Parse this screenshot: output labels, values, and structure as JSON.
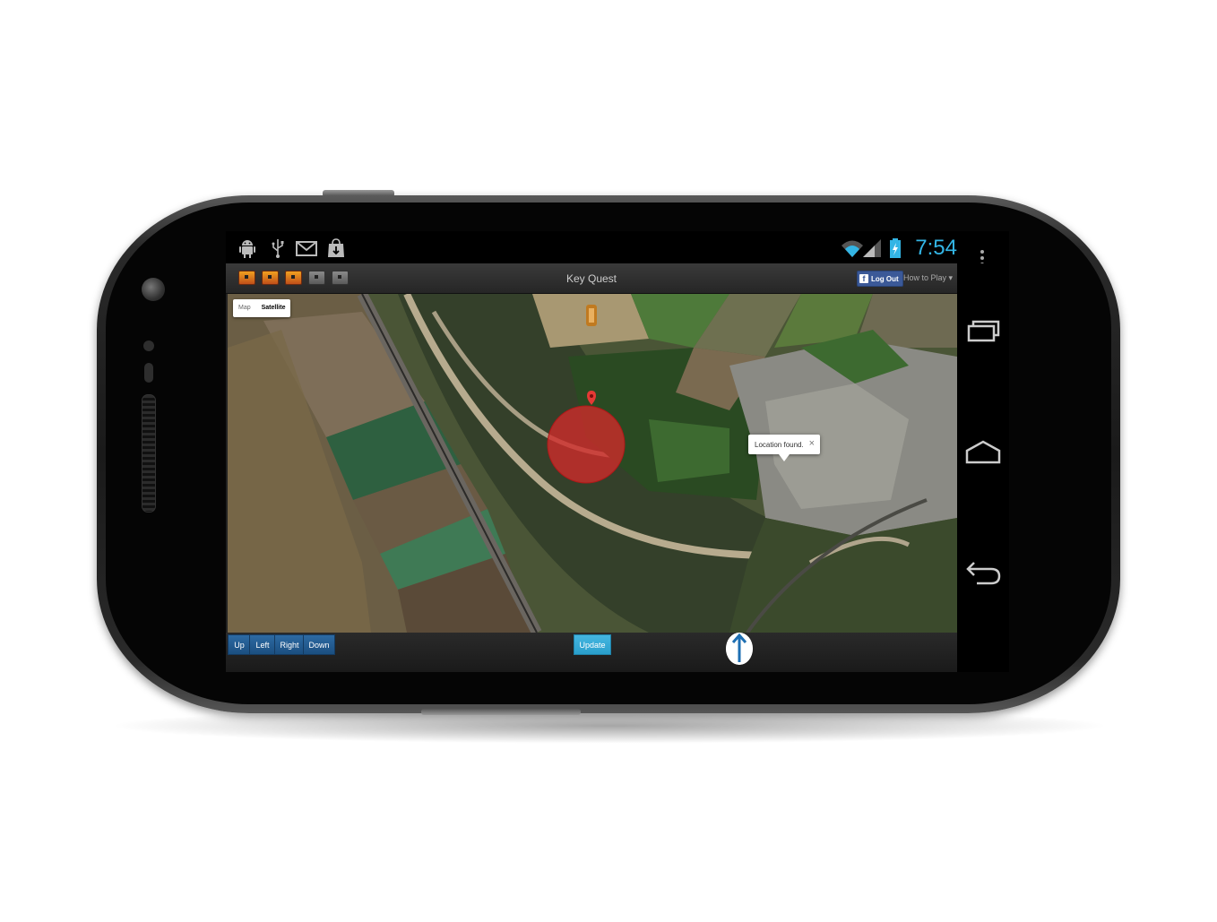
{
  "status_bar": {
    "icons": [
      "android-debug-icon",
      "usb-icon",
      "gmail-icon",
      "download-icon"
    ],
    "clock": "7:54",
    "clock_color": "#33b5e5"
  },
  "app": {
    "title": "Key Quest",
    "chests": [
      {
        "state": "collected"
      },
      {
        "state": "collected"
      },
      {
        "state": "collected"
      },
      {
        "state": "empty"
      },
      {
        "state": "empty"
      }
    ],
    "facebook_button": "Log Out",
    "how_to_play": "How to Play ▾"
  },
  "map": {
    "type_options": [
      {
        "label": "Map",
        "active": false
      },
      {
        "label": "Satellite",
        "active": true
      }
    ],
    "info_window_text": "Location found.",
    "info_window_close": "×"
  },
  "footer": {
    "up": "Up",
    "left": "Left",
    "right": "Right",
    "down": "Down",
    "update": "Update"
  },
  "colors": {
    "accent": "#33b5e5",
    "button_blue": "#1b4f80",
    "update_cyan": "#2a9fcc",
    "location_circle": "#d22a2a"
  }
}
